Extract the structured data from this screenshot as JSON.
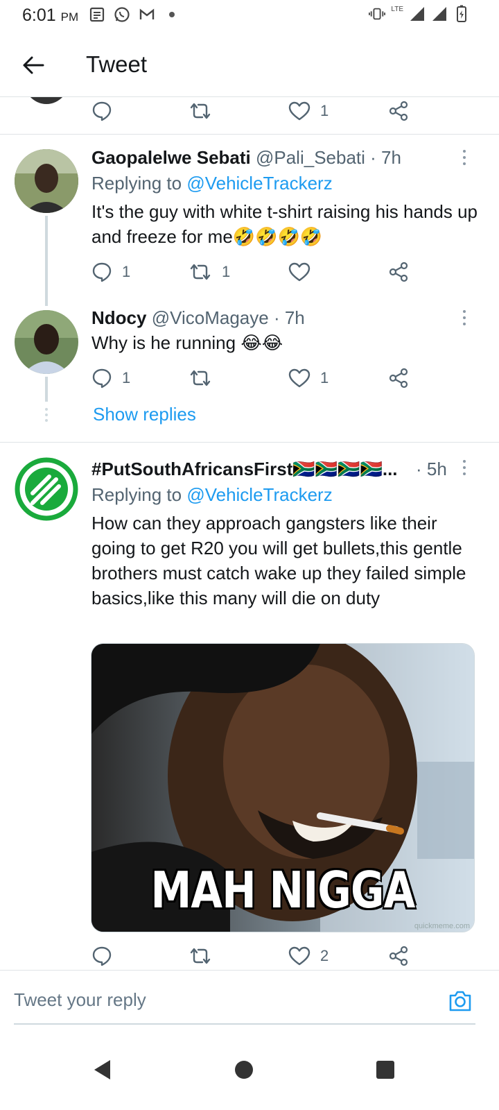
{
  "status_bar": {
    "time": "6:01",
    "ampm": "PM",
    "network": "LTE"
  },
  "app_bar": {
    "title": "Tweet"
  },
  "top_actions": {
    "like_count": "1"
  },
  "tweets": [
    {
      "name": "Gaopalelwe Sebati",
      "handle": "@Pali_Sebati",
      "time": "· 7h",
      "replying_prefix": "Replying to ",
      "replying_to": "@VehicleTrackerz",
      "text": "It's the guy with white t-shirt raising his hands up and freeze for me🤣🤣🤣🤣",
      "reply_count": "1",
      "retweet_count": "1",
      "like_count": ""
    },
    {
      "name": "Ndocy",
      "handle": "@VicoMagaye",
      "time": "· 7h",
      "text": "Why is he running 😂😂",
      "reply_count": "1",
      "retweet_count": "",
      "like_count": "1",
      "show_replies": "Show replies"
    },
    {
      "name": "#PutSouthAfricansFirst🇿🇦🇿🇦🇿🇦🇿🇦...",
      "time": "· 5h",
      "replying_prefix": "Replying to ",
      "replying_to": "@VehicleTrackerz",
      "text": "How can they approach gangsters like their going to get R20 you will get bullets,this gentle brothers must catch wake up they failed simple basics,like this many will die on duty",
      "media_caption": "MAH NIGGA",
      "media_watermark": "quickmeme.com",
      "reply_count": "",
      "retweet_count": "",
      "like_count": "2"
    }
  ],
  "reply_bar": {
    "placeholder": "Tweet your reply"
  },
  "colors": {
    "accent": "#1d9bf0",
    "secondary_text": "#536471",
    "divider": "#dfe3e6"
  }
}
